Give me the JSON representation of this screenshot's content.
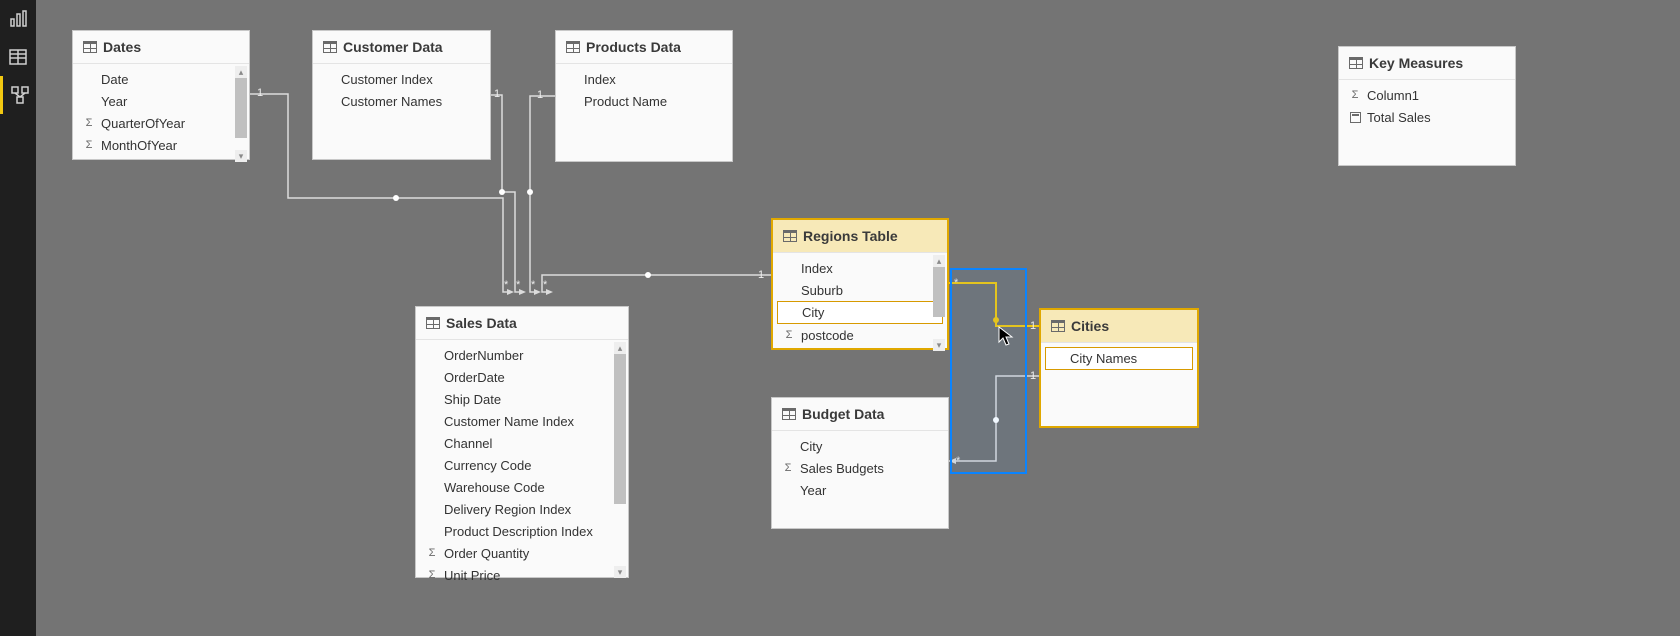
{
  "nav": {
    "items": [
      {
        "name": "report-view-icon",
        "active": false
      },
      {
        "name": "data-view-icon",
        "active": false
      },
      {
        "name": "model-view-icon",
        "active": true
      }
    ]
  },
  "tables": {
    "dates": {
      "title": "Dates",
      "fields": [
        {
          "label": "Date",
          "icon": ""
        },
        {
          "label": "Year",
          "icon": ""
        },
        {
          "label": "QuarterOfYear",
          "icon": "sigma"
        },
        {
          "label": "MonthOfYear",
          "icon": "sigma"
        }
      ]
    },
    "customer": {
      "title": "Customer Data",
      "fields": [
        {
          "label": "Customer Index",
          "icon": ""
        },
        {
          "label": "Customer Names",
          "icon": ""
        }
      ]
    },
    "products": {
      "title": "Products Data",
      "fields": [
        {
          "label": "Index",
          "icon": ""
        },
        {
          "label": "Product Name",
          "icon": ""
        }
      ]
    },
    "keymeasures": {
      "title": "Key Measures",
      "fields": [
        {
          "label": "Column1",
          "icon": "sigma"
        },
        {
          "label": "Total Sales",
          "icon": "calc"
        }
      ]
    },
    "regions": {
      "title": "Regions Table",
      "fields": [
        {
          "label": "Index",
          "icon": ""
        },
        {
          "label": "Suburb",
          "icon": ""
        },
        {
          "label": "City",
          "icon": "",
          "selected": true
        },
        {
          "label": "postcode",
          "icon": "sigma"
        }
      ]
    },
    "sales": {
      "title": "Sales Data",
      "fields": [
        {
          "label": "OrderNumber",
          "icon": ""
        },
        {
          "label": "OrderDate",
          "icon": ""
        },
        {
          "label": "Ship Date",
          "icon": ""
        },
        {
          "label": "Customer Name Index",
          "icon": ""
        },
        {
          "label": "Channel",
          "icon": ""
        },
        {
          "label": "Currency Code",
          "icon": ""
        },
        {
          "label": "Warehouse Code",
          "icon": ""
        },
        {
          "label": "Delivery Region Index",
          "icon": ""
        },
        {
          "label": "Product Description Index",
          "icon": ""
        },
        {
          "label": "Order Quantity",
          "icon": "sigma"
        },
        {
          "label": "Unit Price",
          "icon": "sigma"
        }
      ]
    },
    "budget": {
      "title": "Budget Data",
      "fields": [
        {
          "label": "City",
          "icon": ""
        },
        {
          "label": "Sales Budgets",
          "icon": "sigma"
        },
        {
          "label": "Year",
          "icon": ""
        }
      ]
    },
    "cities": {
      "title": "Cities",
      "fields": [
        {
          "label": "City Names",
          "icon": "",
          "selected": true
        }
      ]
    }
  },
  "relationship_labels": {
    "one": "1",
    "many": "*"
  }
}
